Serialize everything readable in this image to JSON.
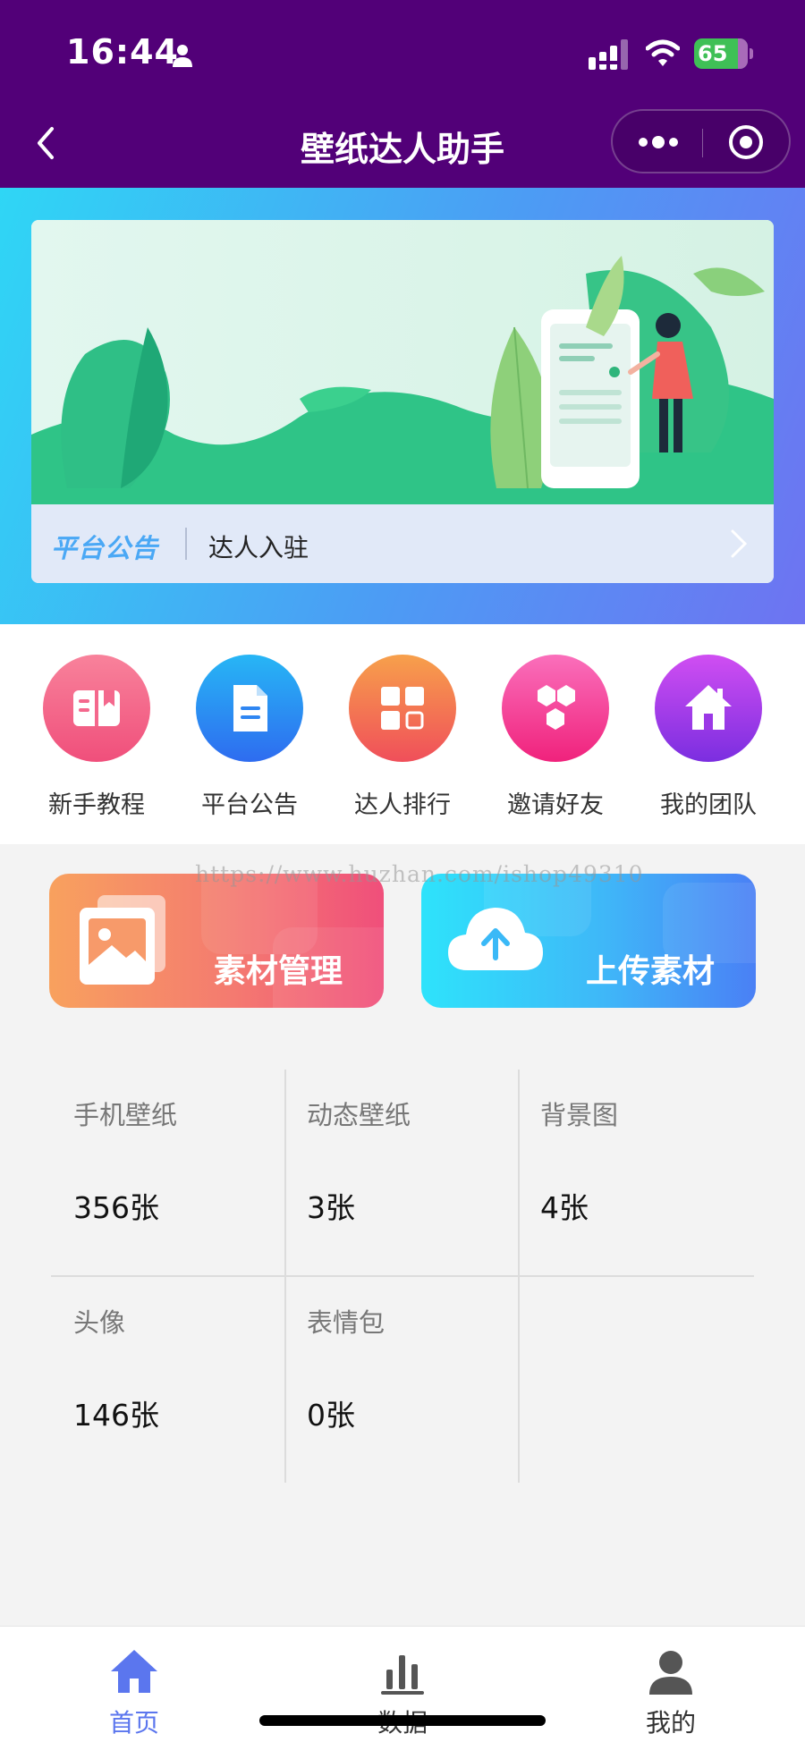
{
  "status_bar": {
    "time": "16:44",
    "battery": "65",
    "battery_level": 0.65,
    "icons": [
      "person-icon",
      "signal-icon",
      "wifi-icon",
      "battery-charging-icon"
    ]
  },
  "nav": {
    "title": "壁纸达人助手",
    "icons": [
      "back-icon",
      "more-icon",
      "target-icon"
    ]
  },
  "banner": {
    "notice_tag": "平台公告",
    "notice_text": "达人入驻"
  },
  "menu": {
    "items": [
      {
        "label": "新手教程",
        "icon": "book-icon",
        "color": "#f25c84"
      },
      {
        "label": "平台公告",
        "icon": "document-icon",
        "color": "#2b86f2"
      },
      {
        "label": "达人排行",
        "icon": "grid-icon",
        "color": "#f56a4a"
      },
      {
        "label": "邀请好友",
        "icon": "hexagon-icon",
        "color": "#f23f9a"
      },
      {
        "label": "我的团队",
        "icon": "house-icon",
        "color": "#9b38e6"
      }
    ]
  },
  "actions": {
    "manage_label": "素材管理",
    "upload_label": "上传素材"
  },
  "watermark": "https://www.huzhan.com/ishop49310",
  "stats": [
    {
      "label": "手机壁纸",
      "value": "356张"
    },
    {
      "label": "动态壁纸",
      "value": "3张"
    },
    {
      "label": "背景图",
      "value": "4张"
    },
    {
      "label": "头像",
      "value": "146张"
    },
    {
      "label": "表情包",
      "value": "0张"
    }
  ],
  "tabbar": {
    "tabs": [
      {
        "label": "首页",
        "icon": "home-icon",
        "active": true
      },
      {
        "label": "数据",
        "icon": "bar-chart-icon",
        "active": false
      },
      {
        "label": "我的",
        "icon": "user-icon",
        "active": false
      }
    ],
    "active_color": "#5b76ee",
    "inactive_color": "#333333"
  }
}
